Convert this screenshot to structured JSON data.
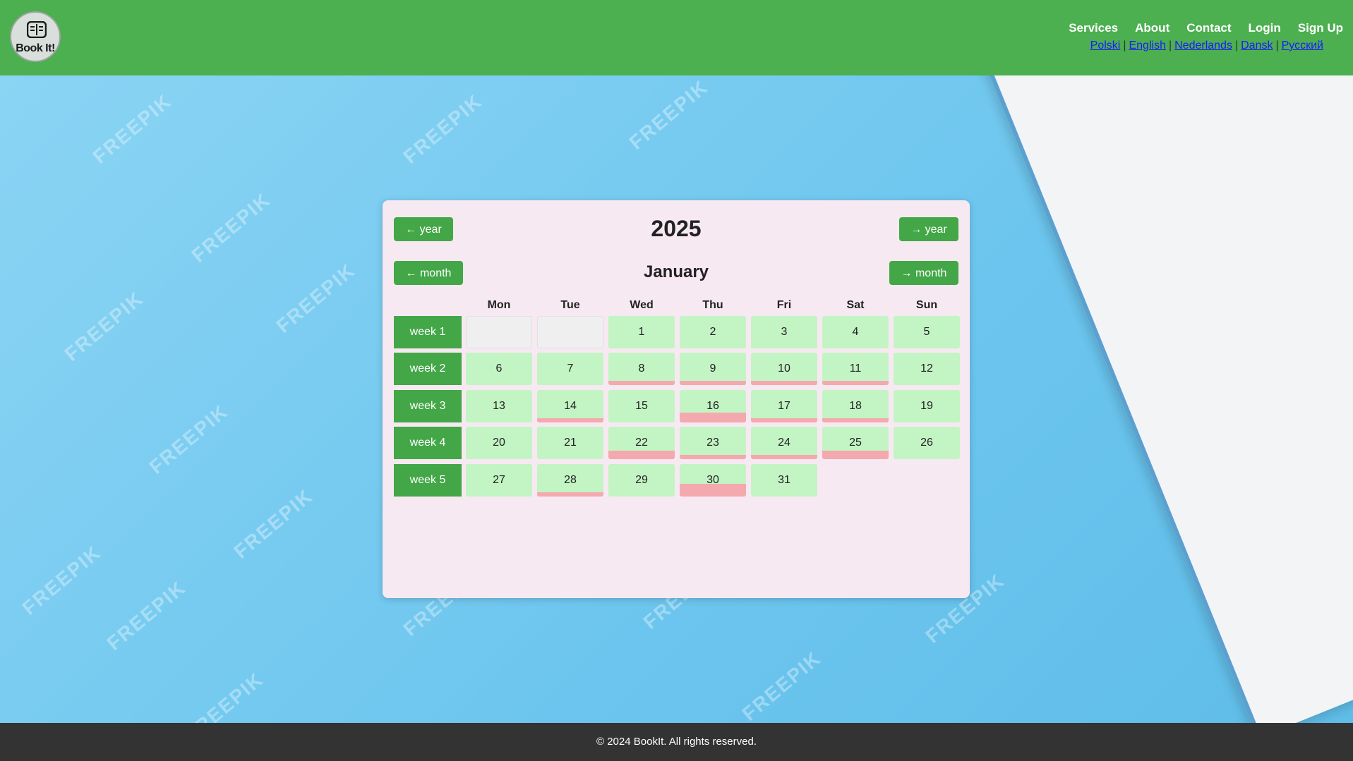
{
  "header": {
    "logo_text": "Book It!",
    "nav": [
      "Services",
      "About",
      "Contact",
      "Login",
      "Sign Up"
    ],
    "languages": [
      "Polski",
      "English",
      "Nederlands",
      "Dansk",
      "Русский"
    ]
  },
  "calendar": {
    "year": "2025",
    "month": "January",
    "prev_year_label": "← year",
    "next_year_label": "→ year",
    "prev_month_label": "← month",
    "next_month_label": "→ month",
    "day_headers": [
      "Mon",
      "Tue",
      "Wed",
      "Thu",
      "Fri",
      "Sat",
      "Sun"
    ],
    "weeks": [
      {
        "label": "week 1",
        "days": [
          {
            "day": "",
            "empty": true,
            "booked_fraction": 0
          },
          {
            "day": "",
            "empty": true,
            "booked_fraction": 0
          },
          {
            "day": "1",
            "booked_fraction": 0
          },
          {
            "day": "2",
            "booked_fraction": 0
          },
          {
            "day": "3",
            "booked_fraction": 0
          },
          {
            "day": "4",
            "booked_fraction": 0
          },
          {
            "day": "5",
            "booked_fraction": 0
          }
        ]
      },
      {
        "label": "week 2",
        "days": [
          {
            "day": "6",
            "booked_fraction": 0
          },
          {
            "day": "7",
            "booked_fraction": 0
          },
          {
            "day": "8",
            "booked_fraction": 0.13
          },
          {
            "day": "9",
            "booked_fraction": 0.13
          },
          {
            "day": "10",
            "booked_fraction": 0.13
          },
          {
            "day": "11",
            "booked_fraction": 0.13
          },
          {
            "day": "12",
            "booked_fraction": 0
          }
        ]
      },
      {
        "label": "week 3",
        "days": [
          {
            "day": "13",
            "booked_fraction": 0
          },
          {
            "day": "14",
            "booked_fraction": 0.13
          },
          {
            "day": "15",
            "booked_fraction": 0
          },
          {
            "day": "16",
            "booked_fraction": 0.3
          },
          {
            "day": "17",
            "booked_fraction": 0.13
          },
          {
            "day": "18",
            "booked_fraction": 0.13
          },
          {
            "day": "19",
            "booked_fraction": 0
          }
        ]
      },
      {
        "label": "week 4",
        "days": [
          {
            "day": "20",
            "booked_fraction": 0
          },
          {
            "day": "21",
            "booked_fraction": 0
          },
          {
            "day": "22",
            "booked_fraction": 0.26
          },
          {
            "day": "23",
            "booked_fraction": 0.13
          },
          {
            "day": "24",
            "booked_fraction": 0.13
          },
          {
            "day": "25",
            "booked_fraction": 0.26
          },
          {
            "day": "26",
            "booked_fraction": 0
          }
        ]
      },
      {
        "label": "week 5",
        "days": [
          {
            "day": "27",
            "booked_fraction": 0
          },
          {
            "day": "28",
            "booked_fraction": 0.13
          },
          {
            "day": "29",
            "booked_fraction": 0
          },
          {
            "day": "30",
            "booked_fraction": 0.4
          },
          {
            "day": "31",
            "booked_fraction": 0
          }
        ]
      }
    ]
  },
  "footer": {
    "text": "© 2024 BookIt. All rights reserved."
  },
  "colors": {
    "header_bg": "#4caf50",
    "button_bg": "#43a747",
    "available_day": "#c3f4c4",
    "booked_bar": "#f4a9ae",
    "card_bg": "#f7e9f1",
    "footer_bg": "#333333"
  }
}
